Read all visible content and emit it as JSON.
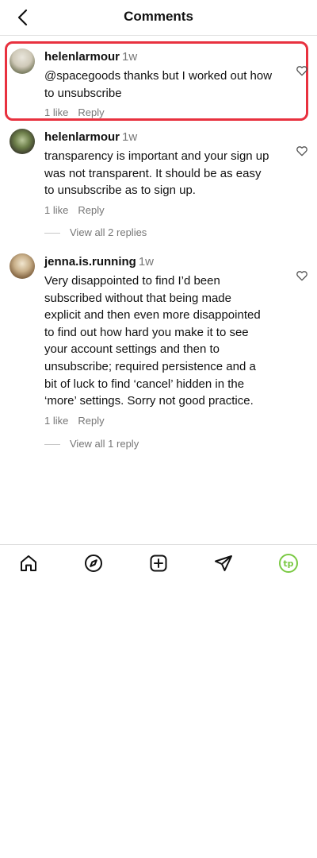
{
  "header": {
    "title": "Comments",
    "back_icon": "chevron-left-icon"
  },
  "comments": [
    {
      "username": "helenlarmour",
      "time": "1w",
      "text": "@spacegoods thanks but I worked out how to unsubscribe",
      "likes": "1 like",
      "reply": "Reply",
      "highlighted": true
    },
    {
      "username": "helenlarmour",
      "time": "1w",
      "text": "transparency is important and your sign up was not transparent. It should be as easy to unsubscribe as to sign up.",
      "likes": "1 like",
      "reply": "Reply",
      "view_replies": "View all 2 replies"
    },
    {
      "username": "jenna.is.running",
      "time": "1w",
      "text": "Very disappointed to find I’d been subscribed without that being made explicit and then even more disappointed to find out how hard you make it to see your account settings and then to unsubscribe; required persistence and a bit of luck to find ‘cancel’ hidden in the ‘more’ settings. Sorry not good practice.",
      "likes": "1 like",
      "reply": "Reply",
      "view_replies": "View all 1 reply"
    }
  ],
  "bottom_nav": {
    "items": [
      "home-icon",
      "explore-icon",
      "create-icon",
      "direct-message-icon",
      "profile-icon"
    ],
    "profile_initials": "tp",
    "profile_color": "#7ac943"
  },
  "colors": {
    "highlight": "#e8313f",
    "muted": "#777777"
  }
}
